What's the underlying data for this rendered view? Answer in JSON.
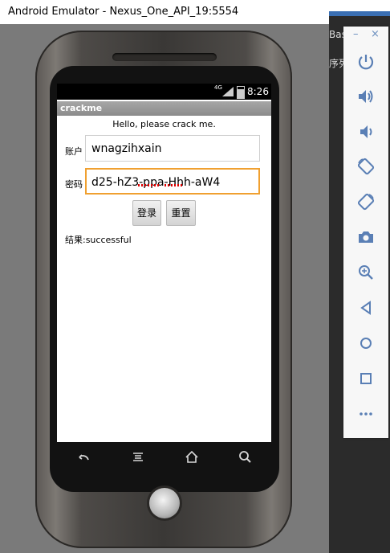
{
  "window": {
    "title": "Android Emulator - Nexus_One_API_19:5554"
  },
  "background": {
    "text1": "Bas",
    "text2": "序列"
  },
  "status_bar": {
    "network": "4G",
    "time": "8:26"
  },
  "app": {
    "name": "crackme",
    "hello": "Hello, please crack me.",
    "account_label": "账户",
    "account_value": "wnagzihxain",
    "password_label": "密码",
    "password_value": "d25-hZ3-ppa-Hhh-aW4",
    "login_button": "登录",
    "reset_button": "重置",
    "result": "结果:successful"
  },
  "nav_keys": [
    "back-icon",
    "menu-icon",
    "home-icon",
    "search-icon"
  ],
  "toolbar": {
    "minimize": "–",
    "close": "×",
    "icons": [
      "power-icon",
      "volume-up-icon",
      "volume-down-icon",
      "rotate-left-icon",
      "rotate-right-icon",
      "camera-icon",
      "zoom-icon",
      "back-icon",
      "home-icon",
      "overview-icon",
      "more-icon"
    ]
  },
  "colors": {
    "focus_border": "#f0a030",
    "toolbar_icon": "#5a7fb5",
    "actionbar": "#9a9a9a"
  }
}
